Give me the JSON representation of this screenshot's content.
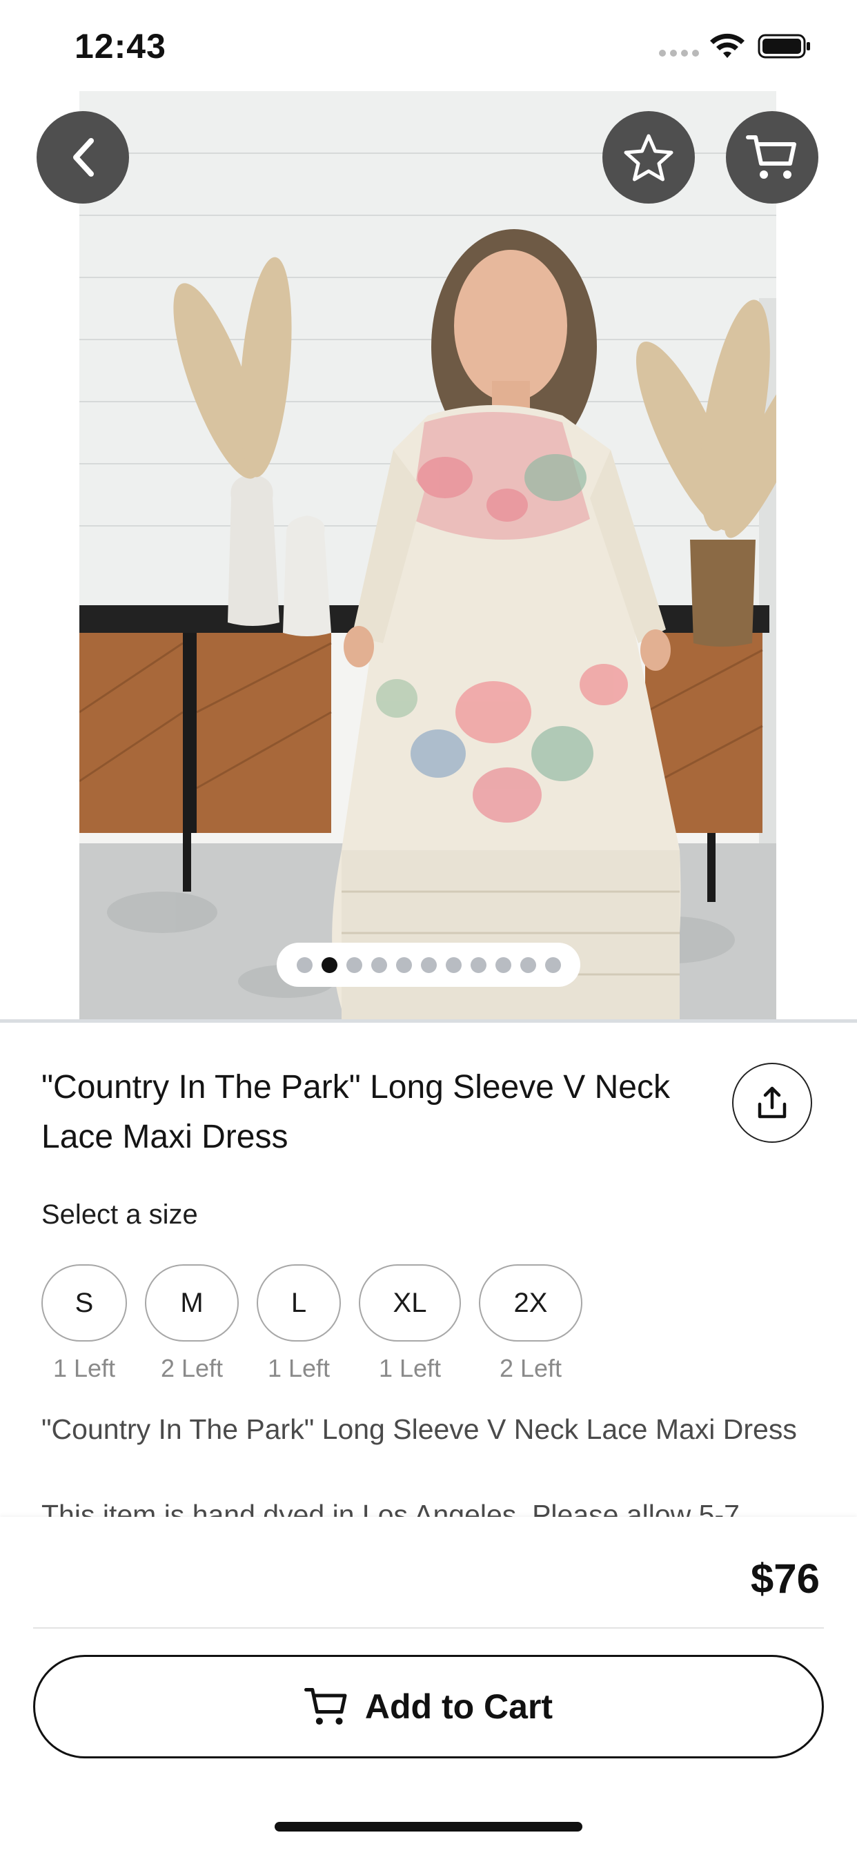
{
  "status_bar": {
    "time": "12:43"
  },
  "product": {
    "title": "\"Country In The Park\" Long Sleeve V Neck Lace Maxi Dress",
    "image_count": 11,
    "active_image_index": 1,
    "size_prompt": "Select a size",
    "sizes": [
      {
        "label": "S",
        "stock": "1 Left"
      },
      {
        "label": "M",
        "stock": "2 Left"
      },
      {
        "label": "L",
        "stock": "1 Left"
      },
      {
        "label": "XL",
        "stock": "1 Left"
      },
      {
        "label": "2X",
        "stock": "2 Left"
      }
    ],
    "description_title": "\"Country In The Park\" Long Sleeve V Neck Lace Maxi Dress",
    "description_body": "This item is hand dyed in Los Angeles. Please allow 5-7"
  },
  "footer": {
    "price": "$76",
    "add_to_cart_label": "Add to Cart"
  },
  "icons": {
    "back": "chevron-left-icon",
    "favorite": "star-icon",
    "cart": "cart-icon",
    "share": "share-icon"
  },
  "colors": {
    "overlay_button": "#4f4f4f",
    "pager_active": "#111111",
    "pager_inactive": "#b8bcc2",
    "chip_border": "#a7a7a7"
  }
}
